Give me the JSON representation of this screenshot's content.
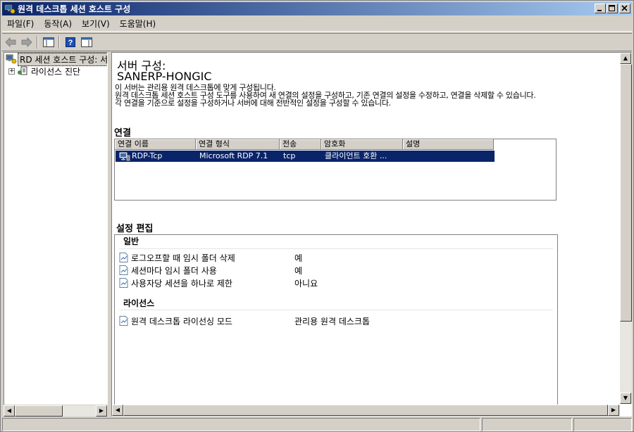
{
  "window": {
    "title": "원격 데스크톱 세션 호스트 구성"
  },
  "menu": [
    {
      "label": "파일(F)"
    },
    {
      "label": "동작(A)"
    },
    {
      "label": "보기(V)"
    },
    {
      "label": "도움말(H)"
    }
  ],
  "tree": {
    "items": [
      {
        "label": "RD 세션 호스트 구성: 서버",
        "selected": true
      },
      {
        "label": "라이선스 진단",
        "expander": "+"
      }
    ]
  },
  "main": {
    "heading": "서버 구성:",
    "server_name": "SANERP-HONGIC",
    "desc_lines": [
      "이 서버는 관리용 원격 데스크톱에 맞게 구성됩니다.",
      "원격 데스크톱 세션 호스트 구성 도구를 사용하여 새 연결의 설정을 구성하고, 기존 연결의 설정을 수정하고, 연결을 삭제할 수 있습니다.",
      "각 연결을 기준으로 설정을 구성하거나 서버에 대해 전반적인 설정을 구성할 수 있습니다."
    ],
    "connections": {
      "title": "연결",
      "columns": [
        "연결 이름",
        "연결 형식",
        "전송",
        "암호화",
        "설명"
      ],
      "rows": [
        {
          "name": "RDP-Tcp",
          "type": "Microsoft RDP 7.1",
          "transport": "tcp",
          "encryption": "클라이언트 호환 ...",
          "description": ""
        }
      ]
    },
    "settings": {
      "title": "설정 편집",
      "groups": [
        {
          "name": "일반",
          "items": [
            {
              "label": "로그오프할 때 임시 폴더 삭제",
              "value": "예"
            },
            {
              "label": "세션마다 임시 폴더 사용",
              "value": "예"
            },
            {
              "label": "사용자당 세션을 하나로 제한",
              "value": "아니요"
            }
          ]
        },
        {
          "name": "라이선스",
          "items": [
            {
              "label": "원격 데스크톱 라이선싱 모드",
              "value": "관리용 원격 데스크톱"
            }
          ]
        }
      ]
    }
  },
  "colors": {
    "titlebar_start": "#0a246a",
    "titlebar_end": "#a6caf0",
    "selection": "#0a246a",
    "chrome": "#d4d0c8"
  }
}
